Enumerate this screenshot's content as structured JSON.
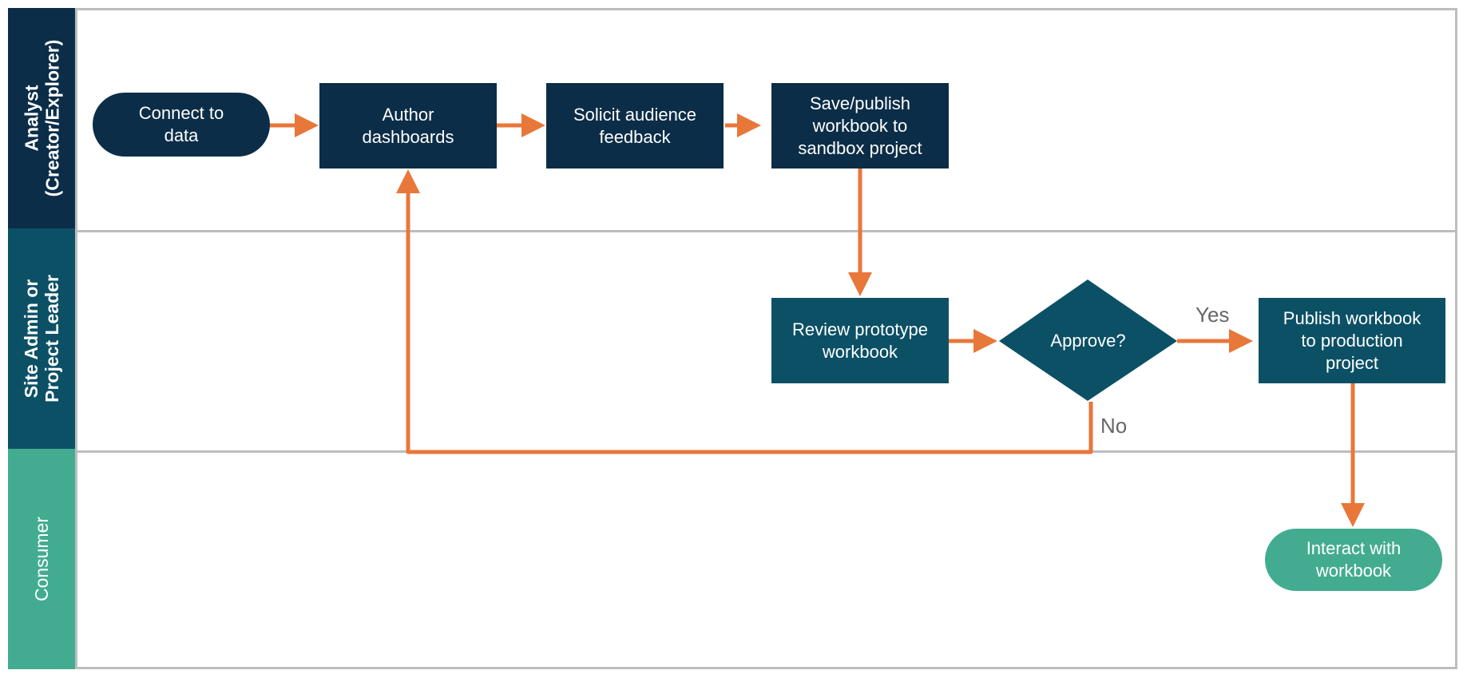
{
  "colors": {
    "navy": "#0b2d48",
    "teal_dark": "#0c5066",
    "teal_green": "#43ac90",
    "arrow": "#e8773a",
    "border": "#bdbdbd",
    "label_gray": "#666666"
  },
  "lanes": [
    {
      "id": "analyst",
      "label": "Analyst\n(Creator/Explorer)"
    },
    {
      "id": "admin",
      "label": "Site Admin or\nProject Leader"
    },
    {
      "id": "consumer",
      "label": "Consumer"
    }
  ],
  "nodes": {
    "connect": {
      "label": "Connect to\ndata",
      "shape": "terminal",
      "lane": "analyst"
    },
    "author": {
      "label": "Author\ndashboards",
      "shape": "process",
      "lane": "analyst"
    },
    "solicit": {
      "label": "Solicit audience\nfeedback",
      "shape": "process",
      "lane": "analyst"
    },
    "save": {
      "label": "Save/publish\nworkbook to\nsandbox project",
      "shape": "process",
      "lane": "analyst"
    },
    "review": {
      "label": "Review prototype\nworkbook",
      "shape": "process",
      "lane": "admin"
    },
    "approve": {
      "label": "Approve?",
      "shape": "decision",
      "lane": "admin"
    },
    "publish": {
      "label": "Publish workbook\nto production\nproject",
      "shape": "process",
      "lane": "admin"
    },
    "interact": {
      "label": "Interact with\nworkbook",
      "shape": "terminal",
      "lane": "consumer"
    }
  },
  "edges": [
    {
      "from": "connect",
      "to": "author",
      "label": ""
    },
    {
      "from": "author",
      "to": "solicit",
      "label": ""
    },
    {
      "from": "solicit",
      "to": "save",
      "label": ""
    },
    {
      "from": "save",
      "to": "review",
      "label": ""
    },
    {
      "from": "review",
      "to": "approve",
      "label": ""
    },
    {
      "from": "approve",
      "to": "publish",
      "label": "Yes"
    },
    {
      "from": "approve",
      "to": "author",
      "label": "No"
    },
    {
      "from": "publish",
      "to": "interact",
      "label": ""
    }
  ],
  "edge_labels": {
    "yes": "Yes",
    "no": "No"
  }
}
